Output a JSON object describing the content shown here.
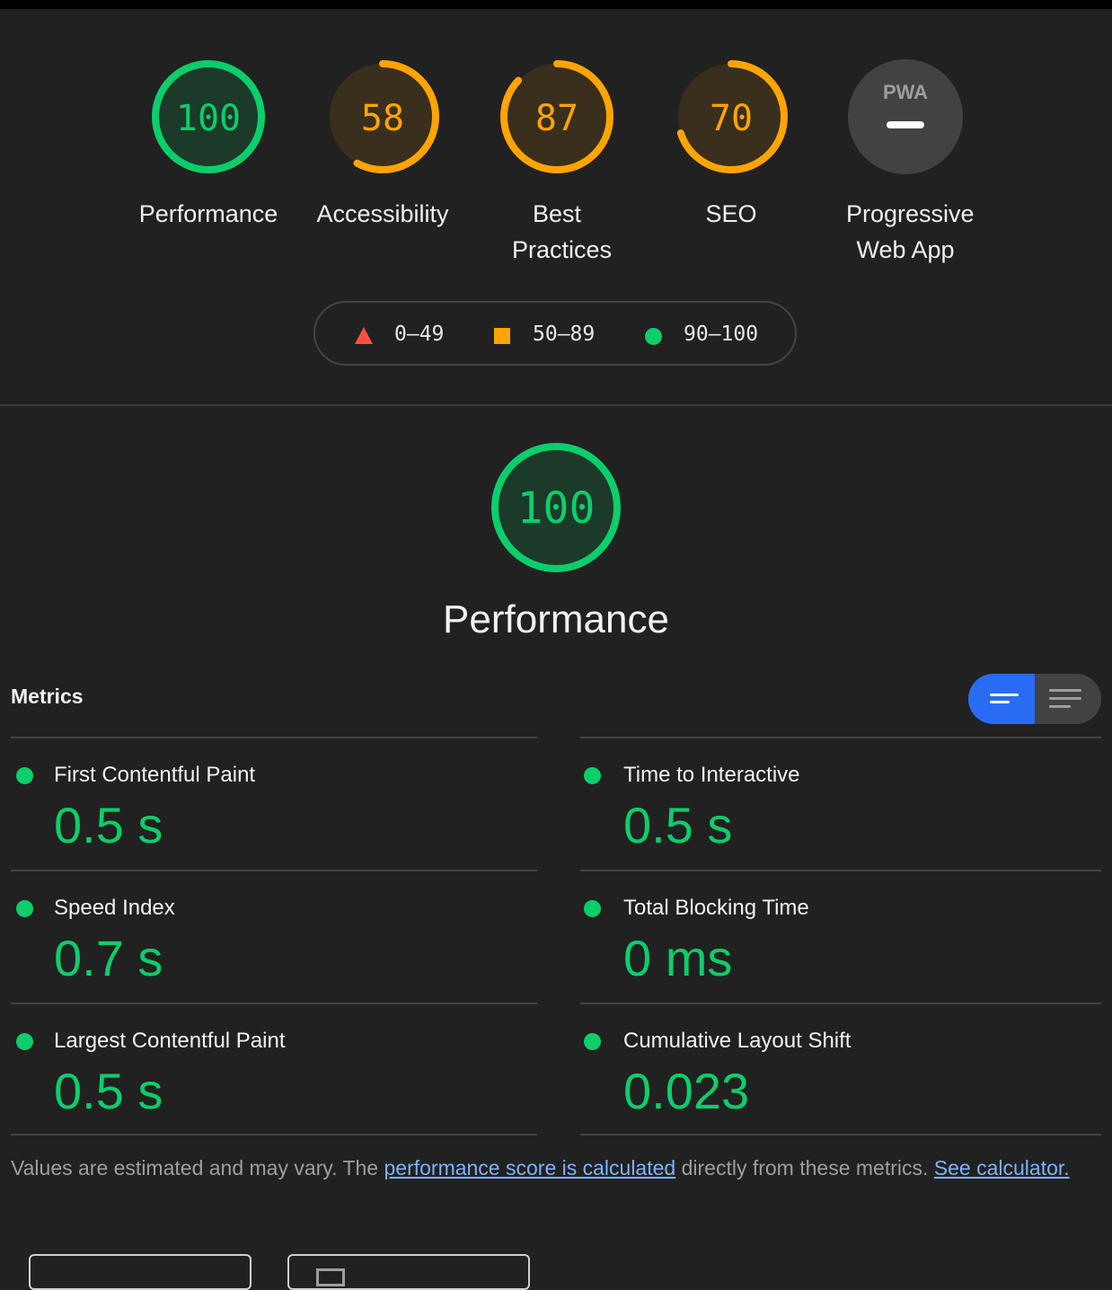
{
  "gauges": [
    {
      "score": "100",
      "label": "Performance",
      "color": "#0cce6b",
      "fill": "#1c3a2a",
      "fraction": 1.0
    },
    {
      "score": "58",
      "label": "Accessibility",
      "color": "#ffa400",
      "fill": "#3a2f1c",
      "fraction": 0.58
    },
    {
      "score": "87",
      "label": "Best Practices",
      "color": "#ffa400",
      "fill": "#3a2f1c",
      "fraction": 0.87
    },
    {
      "score": "70",
      "label": "SEO",
      "color": "#ffa400",
      "fill": "#3a2f1c",
      "fraction": 0.7
    },
    {
      "score": "PWA",
      "label": "Progressive Web App",
      "color": "#888888",
      "fill": "#424242",
      "fraction": 0
    }
  ],
  "legend": {
    "fail": "0–49",
    "average": "50–89",
    "pass": "90–100"
  },
  "performance": {
    "score": "100",
    "title": "Performance",
    "color": "#0cce6b"
  },
  "metrics": {
    "title": "Metrics",
    "left": [
      {
        "label": "First Contentful Paint",
        "value": "0.5 s"
      },
      {
        "label": "Speed Index",
        "value": "0.7 s"
      },
      {
        "label": "Largest Contentful Paint",
        "value": "0.5 s"
      }
    ],
    "right": [
      {
        "label": "Time to Interactive",
        "value": "0.5 s"
      },
      {
        "label": "Total Blocking Time",
        "value": "0 ms"
      },
      {
        "label": "Cumulative Layout Shift",
        "value": "0.023"
      }
    ]
  },
  "note": {
    "prefix": "Values are estimated and may vary. The ",
    "link1": "performance score is calculated",
    "middle": " directly from these metrics. ",
    "link2": "See calculator."
  },
  "icons": [
    "pwa-icon",
    "triangle-icon",
    "square-icon",
    "circle-icon",
    "list-view-icon",
    "detail-view-icon"
  ]
}
